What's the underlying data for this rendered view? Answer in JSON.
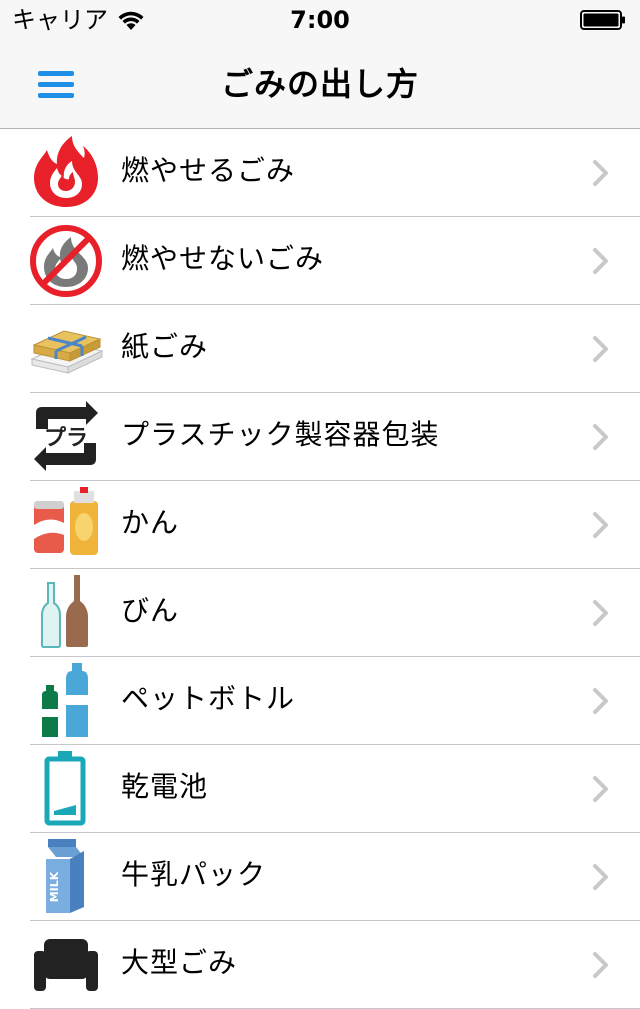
{
  "status_bar": {
    "carrier": "キャリア",
    "time": "7:00",
    "wifi_icon": "wifi-icon",
    "battery_icon": "battery-icon"
  },
  "nav": {
    "title": "ごみの出し方",
    "menu_icon": "hamburger-menu-icon"
  },
  "categories": [
    {
      "label": "燃やせるごみ",
      "icon": "burnable-fire-icon"
    },
    {
      "label": "燃やせないごみ",
      "icon": "non-burnable-icon"
    },
    {
      "label": "紙ごみ",
      "icon": "paper-bundle-icon"
    },
    {
      "label": "プラスチック製容器包装",
      "icon": "plastic-recycle-icon"
    },
    {
      "label": "かん",
      "icon": "cans-icon"
    },
    {
      "label": "びん",
      "icon": "bottles-icon"
    },
    {
      "label": "ペットボトル",
      "icon": "pet-bottle-icon"
    },
    {
      "label": "乾電池",
      "icon": "battery-cell-icon"
    },
    {
      "label": "牛乳パック",
      "icon": "milk-carton-icon"
    },
    {
      "label": "大型ごみ",
      "icon": "large-item-icon"
    }
  ],
  "colors": {
    "accent": "#1e90e8",
    "fire_red": "#e8202a",
    "chevron": "#c7c7cc"
  }
}
